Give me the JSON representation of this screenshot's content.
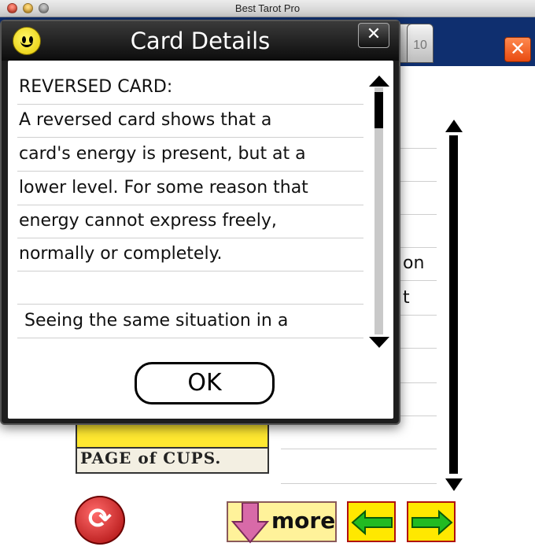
{
  "window": {
    "title": "Best Tarot Pro"
  },
  "app": {
    "tab_label": "10",
    "close_label": "✕",
    "bg_text_1": "on",
    "bg_text_2": "t",
    "card_label": "PAGE of CUPS.",
    "more_label": "more"
  },
  "dialog": {
    "title": "Card Details",
    "close_label": "✕",
    "lines": [
      "REVERSED CARD:",
      "A reversed card shows that a",
      "card's energy is present, but at a",
      "lower level. For some reason that",
      "energy cannot express freely,",
      "normally or completely.",
      "",
      " Seeing the same situation in a"
    ],
    "ok_label": "OK"
  },
  "icons": {
    "smiley": "smiley-face-icon",
    "refresh": "refresh-icon",
    "down_arrow": "down-arrow-icon",
    "left_arrow": "left-arrow-icon",
    "right_arrow": "right-arrow-icon"
  },
  "colors": {
    "header_blue": "#0f2f6f",
    "dialog_dark": "#1e1e1e",
    "button_yellow": "#ffe800",
    "arrow_green": "#22bb22",
    "close_orange": "#e84a10"
  }
}
